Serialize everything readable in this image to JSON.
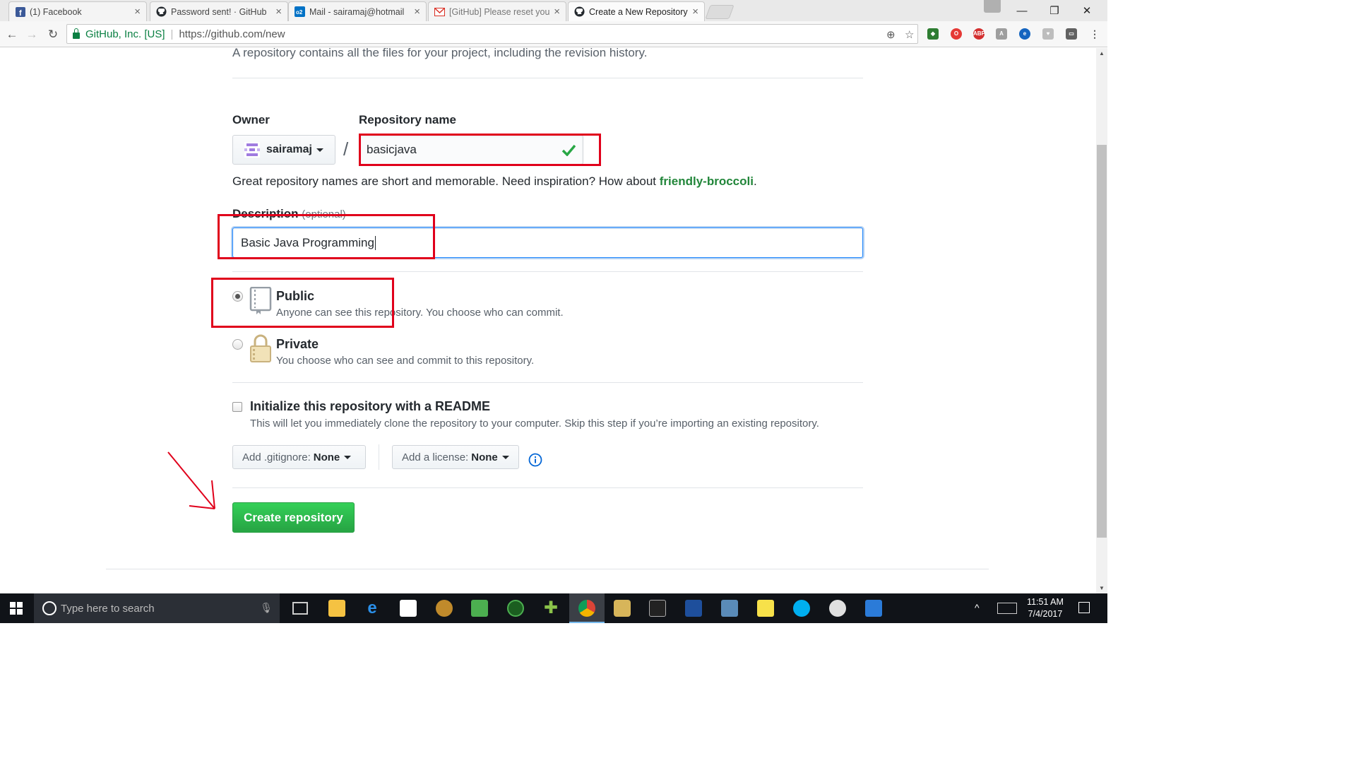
{
  "browser": {
    "tabs": [
      {
        "label": "(1) Facebook",
        "icon": "facebook-icon",
        "color": "#3b5998"
      },
      {
        "label": "Password sent! · GitHub",
        "icon": "github-icon",
        "color": "#24292e"
      },
      {
        "label": "Mail - sairamaj@hotmail",
        "icon": "outlook-icon",
        "color": "#0072c6"
      },
      {
        "label": "[GitHub] Please reset you",
        "icon": "gmail-icon",
        "color": "#d93025"
      },
      {
        "label": "Create a New Repository",
        "icon": "github-icon",
        "color": "#24292e",
        "active": true
      }
    ],
    "address": {
      "secure_label": "GitHub, Inc. [US]",
      "url": "https://github.com/new"
    }
  },
  "page": {
    "intro": "A repository contains all the files for your project, including the revision history.",
    "owner_label": "Owner",
    "owner_value": "sairamaj",
    "slash": "/",
    "repo_name_label": "Repository name",
    "repo_name_value": "basicjava",
    "name_hint_prefix": "Great repository names are short and memorable. Need inspiration? How about ",
    "name_suggestion": "friendly-broccoli",
    "name_hint_suffix": ".",
    "description_label": "Description",
    "description_optional": "(optional)",
    "description_value": "Basic Java Programming",
    "visibility": {
      "selected": "public",
      "public_title": "Public",
      "public_desc": "Anyone can see this repository. You choose who can commit.",
      "private_title": "Private",
      "private_desc": "You choose who can see and commit to this repository."
    },
    "readme": {
      "checked": false,
      "title": "Initialize this repository with a README",
      "desc": "This will let you immediately clone the repository to your computer. Skip this step if you’re importing an existing repository."
    },
    "gitignore_label": "Add .gitignore:",
    "gitignore_value": "None",
    "license_label": "Add a license:",
    "license_value": "None",
    "create_button": "Create repository",
    "colors": {
      "accent_green": "#28a745",
      "annotation_red": "#e0001b",
      "suggestion_green": "#22863a",
      "info_blue": "#0366d6"
    }
  },
  "taskbar": {
    "search_placeholder": "Type here to search",
    "time": "11:51 AM",
    "date": "7/4/2017"
  }
}
